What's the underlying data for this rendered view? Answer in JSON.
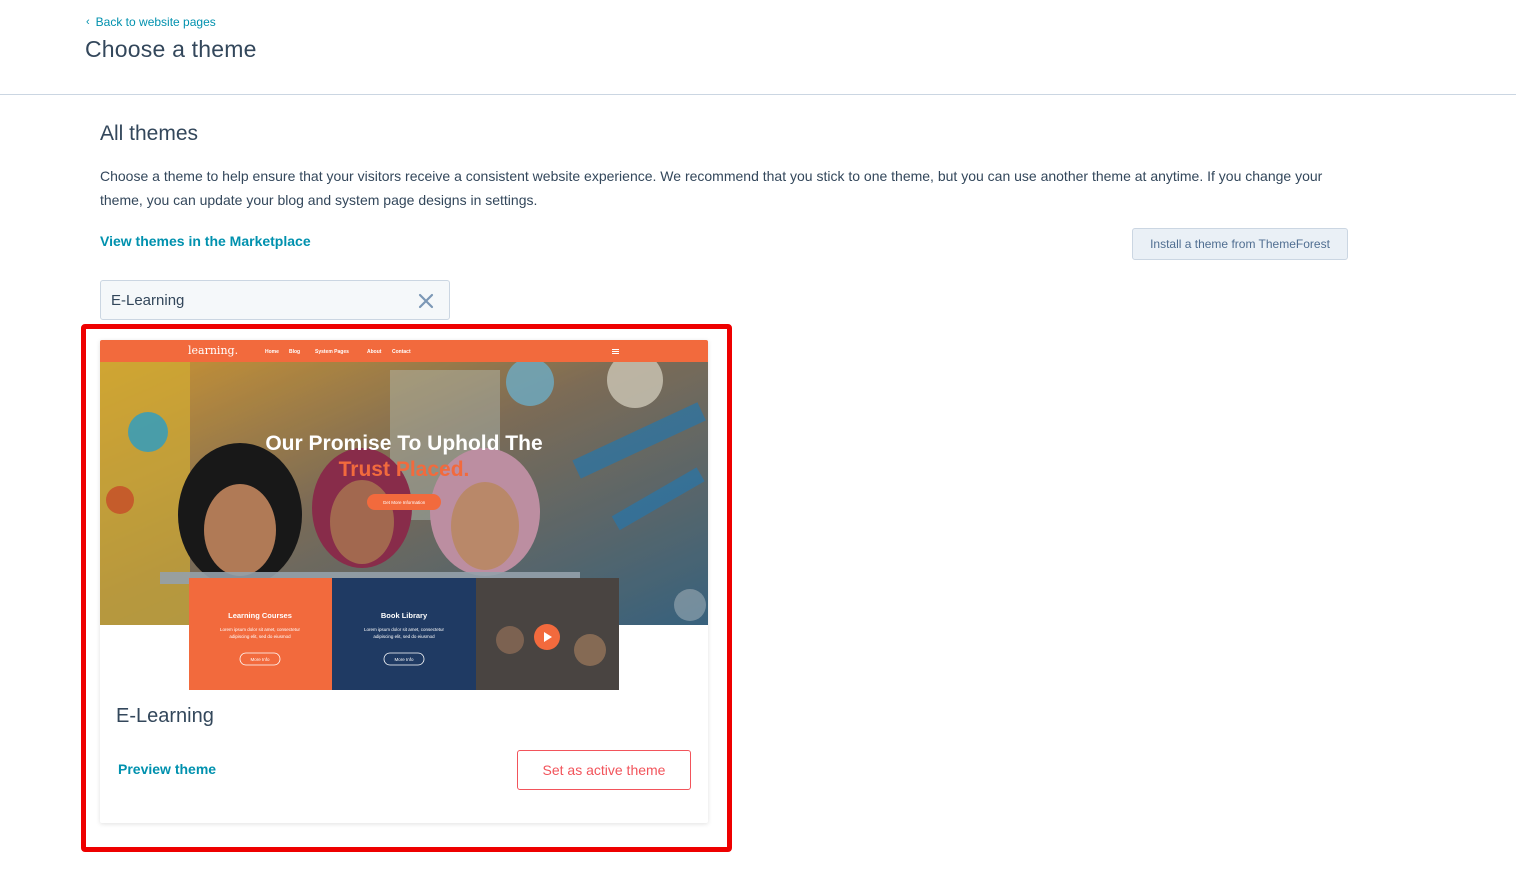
{
  "header": {
    "back_label": "Back to website pages",
    "title": "Choose a theme"
  },
  "section": {
    "title": "All themes",
    "description": "Choose a theme to help ensure that your visitors receive a consistent website experience. We recommend that you stick to one theme, but you can use another theme at anytime. If you change your theme, you can update your blog and system page designs in settings.",
    "marketplace_link": "View themes in the Marketplace",
    "install_button": "Install a theme from ThemeForest"
  },
  "search": {
    "value": "E-Learning",
    "clear_icon": "close-icon"
  },
  "theme_card": {
    "name": "E-Learning",
    "preview_label": "Preview theme",
    "set_active_label": "Set as active theme",
    "thumbnail": {
      "logo": "learning.",
      "nav": [
        "Home",
        "Blog",
        "System Pages",
        "About",
        "Contact"
      ],
      "hero_line1": "Our Promise To Uphold The",
      "hero_line2": "Trust Placed.",
      "hero_button": "Get More Information",
      "box1_title": "Learning Courses",
      "box1_text1": "Lorem ipsum dolor sit amet, consectetur",
      "box1_text2": "adipiscing elit, sed do eiusmod",
      "box1_btn": "More Info",
      "box2_title": "Book Library",
      "box2_text1": "Lorem ipsum dolor sit amet, consectetur",
      "box2_text2": "adipiscing elit, sed do eiusmod",
      "box2_btn": "More Info"
    }
  },
  "colors": {
    "accent_teal": "#0091ae",
    "highlight_red": "#ee0000",
    "theme_orange": "#f26a3d",
    "text_dark": "#33475b"
  }
}
